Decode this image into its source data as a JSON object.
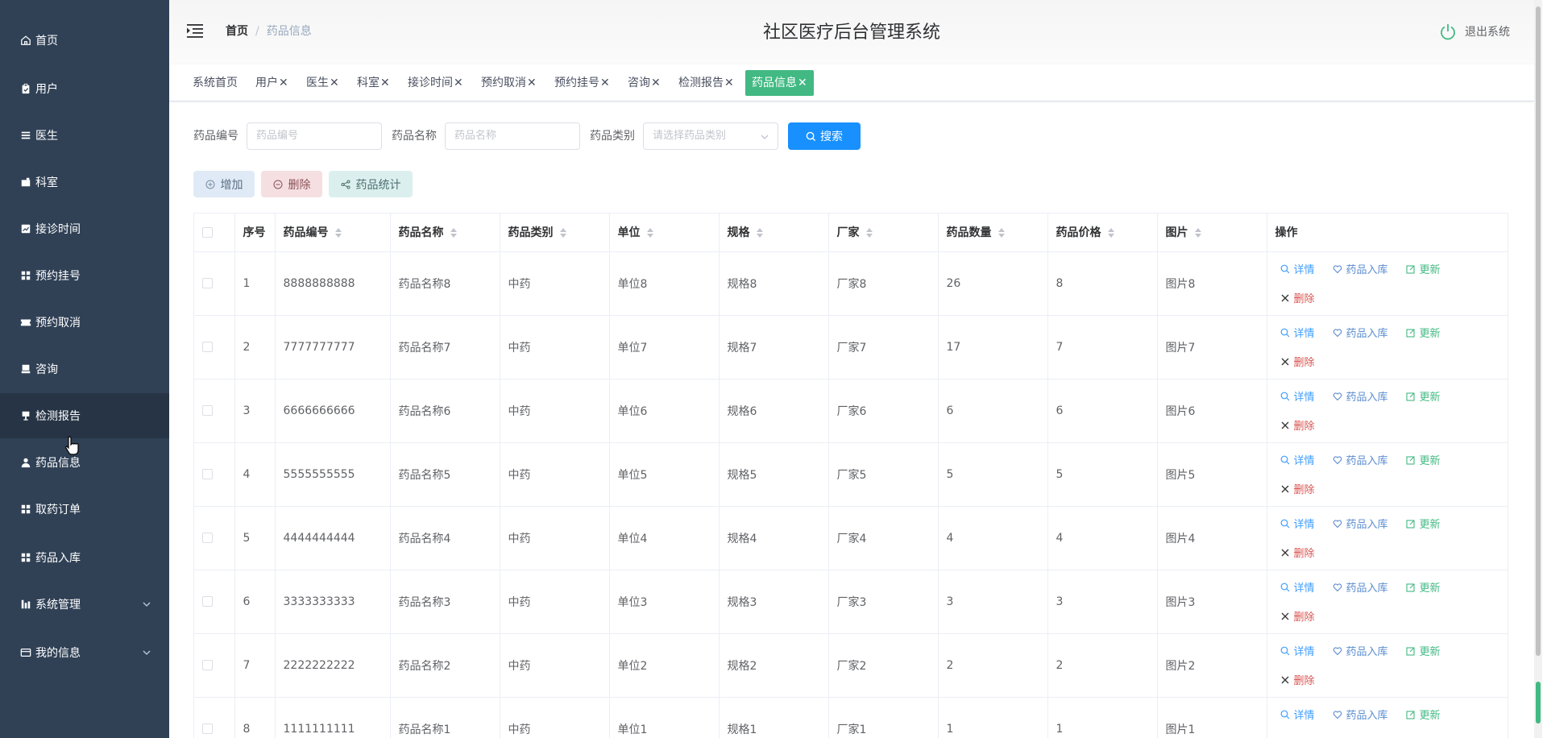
{
  "sidebar": {
    "items": [
      {
        "label": "首页",
        "icon": "home-icon"
      },
      {
        "label": "用户",
        "icon": "clipboard-icon"
      },
      {
        "label": "医生",
        "icon": "list-icon"
      },
      {
        "label": "科室",
        "icon": "briefcase-icon"
      },
      {
        "label": "接诊时间",
        "icon": "chart-icon"
      },
      {
        "label": "预约挂号",
        "icon": "grid-icon"
      },
      {
        "label": "预约取消",
        "icon": "ticket-icon"
      },
      {
        "label": "咨询",
        "icon": "printer-icon"
      },
      {
        "label": "检测报告",
        "icon": "stamp-icon"
      },
      {
        "label": "药品信息",
        "icon": "user-icon"
      },
      {
        "label": "取药订单",
        "icon": "grid-icon"
      },
      {
        "label": "药品入库",
        "icon": "grid-icon"
      },
      {
        "label": "系统管理",
        "icon": "bar-chart-icon"
      },
      {
        "label": "我的信息",
        "icon": "card-icon"
      }
    ]
  },
  "header": {
    "breadcrumb_home": "首页",
    "breadcrumb_sep": "/",
    "breadcrumb_current": "药品信息",
    "title": "社区医疗后台管理系统",
    "logout": "退出系统"
  },
  "tags": [
    {
      "label": "系统首页",
      "closable": ""
    },
    {
      "label": "用户",
      "closable": "✕"
    },
    {
      "label": "医生",
      "closable": "✕"
    },
    {
      "label": "科室",
      "closable": "✕"
    },
    {
      "label": "接诊时间",
      "closable": "✕"
    },
    {
      "label": "预约取消",
      "closable": "✕"
    },
    {
      "label": "预约挂号",
      "closable": "✕"
    },
    {
      "label": "咨询",
      "closable": "✕"
    },
    {
      "label": "检测报告",
      "closable": "✕"
    },
    {
      "label": "药品信息",
      "closable": "✕"
    }
  ],
  "search": {
    "code_label": "药品编号",
    "code_placeholder": "药品编号",
    "name_label": "药品名称",
    "name_placeholder": "药品名称",
    "type_label": "药品类别",
    "type_placeholder": "请选择药品类别",
    "button": "搜索"
  },
  "actions": {
    "add": "增加",
    "delete": "删除",
    "stats": "药品统计"
  },
  "table": {
    "columns": [
      "序号",
      "药品编号",
      "药品名称",
      "药品类别",
      "单位",
      "规格",
      "厂家",
      "药品数量",
      "药品价格",
      "图片",
      "操作"
    ],
    "ops": {
      "detail": "详情",
      "stock_in": "药品入库",
      "update": "更新",
      "delete": "删除"
    },
    "rows": [
      [
        "1",
        "8888888888",
        "药品名称8",
        "中药",
        "单位8",
        "规格8",
        "厂家8",
        "26",
        "8",
        "图片8"
      ],
      [
        "2",
        "7777777777",
        "药品名称7",
        "中药",
        "单位7",
        "规格7",
        "厂家7",
        "17",
        "7",
        "图片7"
      ],
      [
        "3",
        "6666666666",
        "药品名称6",
        "中药",
        "单位6",
        "规格6",
        "厂家6",
        "6",
        "6",
        "图片6"
      ],
      [
        "4",
        "5555555555",
        "药品名称5",
        "中药",
        "单位5",
        "规格5",
        "厂家5",
        "5",
        "5",
        "图片5"
      ],
      [
        "5",
        "4444444444",
        "药品名称4",
        "中药",
        "单位4",
        "规格4",
        "厂家4",
        "4",
        "4",
        "图片4"
      ],
      [
        "6",
        "3333333333",
        "药品名称3",
        "中药",
        "单位3",
        "规格3",
        "厂家3",
        "3",
        "3",
        "图片3"
      ],
      [
        "7",
        "2222222222",
        "药品名称2",
        "中药",
        "单位2",
        "规格2",
        "厂家2",
        "2",
        "2",
        "图片2"
      ],
      [
        "8",
        "1111111111",
        "药品名称1",
        "中药",
        "单位1",
        "规格1",
        "厂家1",
        "1",
        "1",
        "图片1"
      ]
    ]
  },
  "colors": {
    "sidebar_bg": "#304156",
    "sidebar_active": "#263445",
    "tag_active": "#42b983",
    "primary": "#1890ff"
  }
}
